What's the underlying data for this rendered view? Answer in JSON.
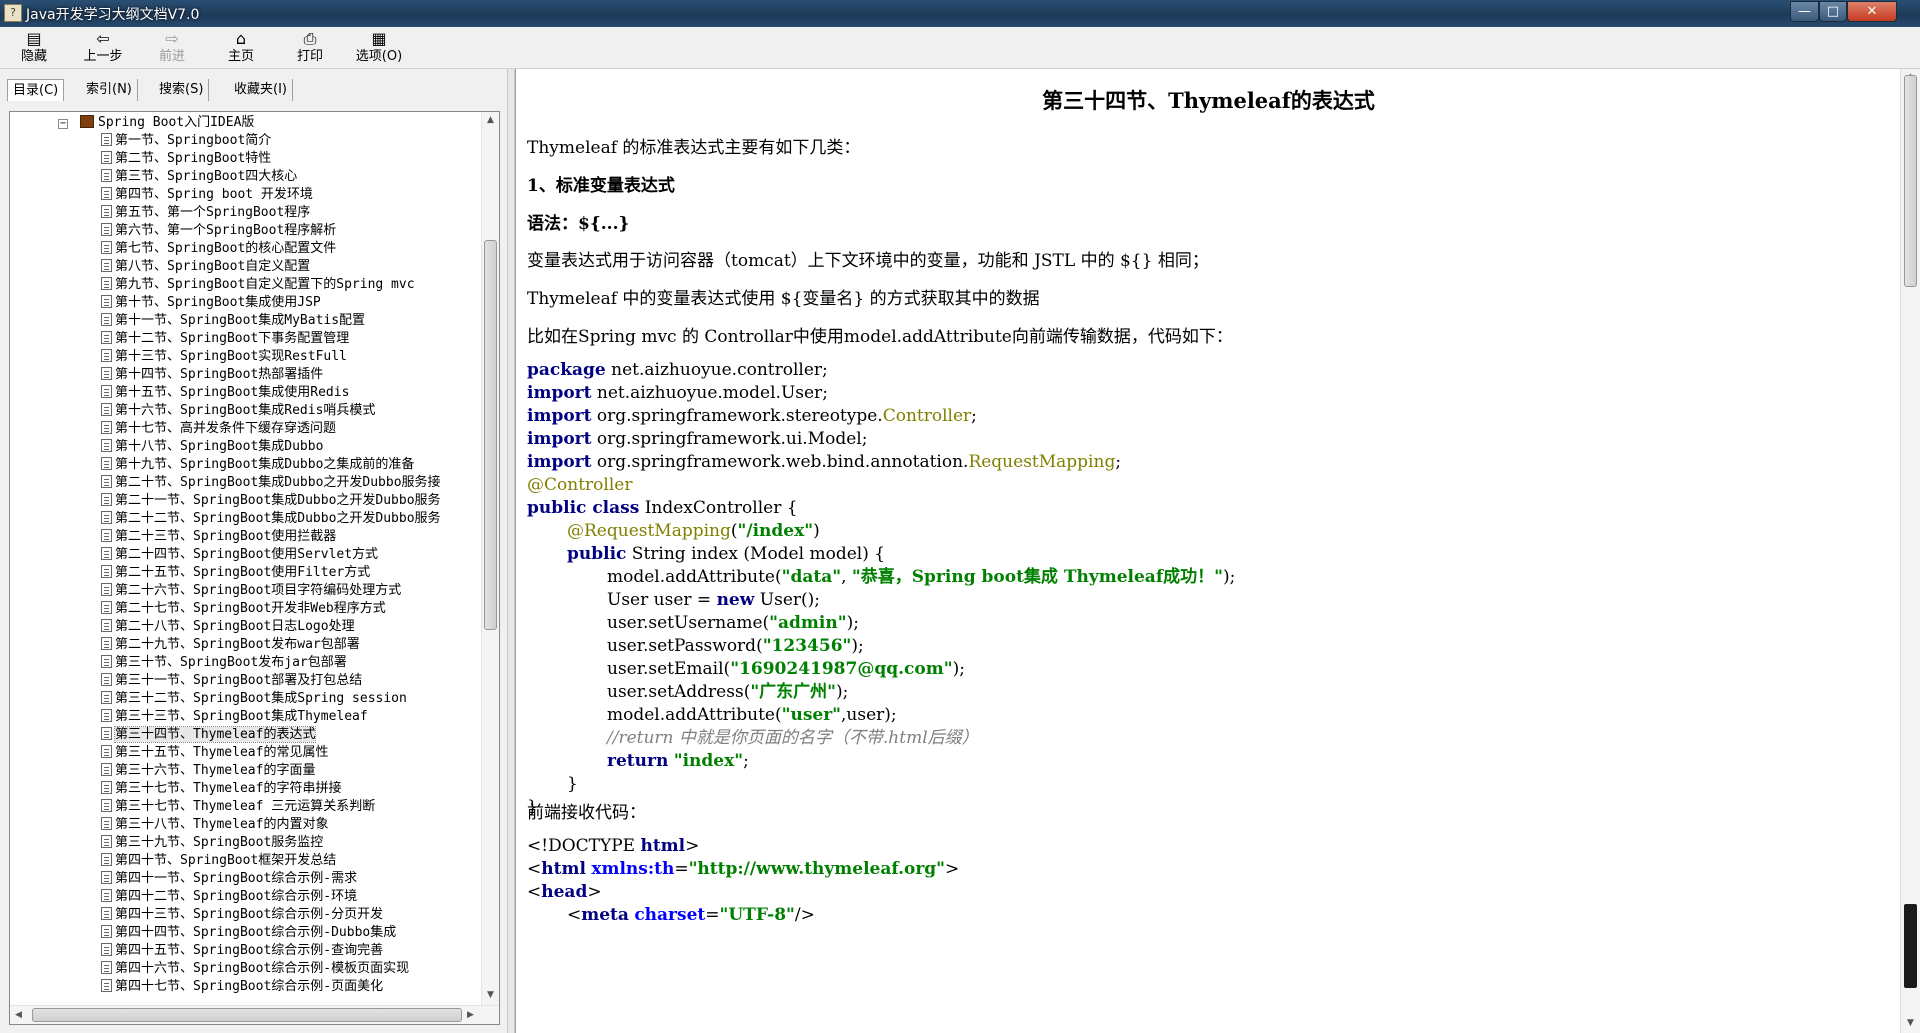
{
  "window": {
    "title": "Java开发学习大纲文档V7.0",
    "min": "—",
    "max": "□",
    "close": "✕"
  },
  "toolbar": [
    {
      "label": "隐藏",
      "icon": "hide-icon",
      "glyph": "▤"
    },
    {
      "label": "上一步",
      "icon": "back-arrow-icon",
      "glyph": "⇦"
    },
    {
      "label": "前进",
      "icon": "forward-arrow-icon",
      "glyph": "⇨"
    },
    {
      "label": "主页",
      "icon": "home-icon",
      "glyph": "⌂"
    },
    {
      "label": "打印",
      "icon": "printer-icon",
      "glyph": "⎙"
    },
    {
      "label": "选项(O)",
      "icon": "options-icon",
      "glyph": "▦"
    }
  ],
  "nav_tabs": [
    "目录(C)",
    "索引(N)",
    "搜索(S)",
    "收藏夹(I)"
  ],
  "tree": {
    "root": "Spring Boot入门IDEA版",
    "selected_index": 33,
    "items": [
      "第一节、Springboot简介",
      "第二节、SpringBoot特性",
      "第三节、SpringBoot四大核心",
      "第四节、Spring boot 开发环境",
      "第五节、第一个SpringBoot程序",
      "第六节、第一个SpringBoot程序解析",
      "第七节、SpringBoot的核心配置文件",
      "第八节、SpringBoot自定义配置",
      "第九节、SpringBoot自定义配置下的Spring mvc",
      "第十节、SpringBoot集成使用JSP",
      "第十一节、SpringBoot集成MyBatis配置",
      "第十二节、SpringBoot下事务配置管理",
      "第十三节、SpringBoot实现RestFull",
      "第十四节、SpringBoot热部署插件",
      "第十五节、SpringBoot集成使用Redis",
      "第十六节、SpringBoot集成Redis哨兵模式",
      "第十七节、高并发条件下缓存穿透问题",
      "第十八节、SpringBoot集成Dubbo",
      "第十九节、SpringBoot集成Dubbo之集成前的准备",
      "第二十节、SpringBoot集成Dubbo之开发Dubbo服务接",
      "第二十一节、SpringBoot集成Dubbo之开发Dubbo服务",
      "第二十二节、SpringBoot集成Dubbo之开发Dubbo服务",
      "第二十三节、SpringBoot使用拦截器",
      "第二十四节、SpringBoot使用Servlet方式",
      "第二十五节、SpringBoot使用Filter方式",
      "第二十六节、SpringBoot项目字符编码处理方式",
      "第二十七节、SpringBoot开发非Web程序方式",
      "第二十八节、SpringBoot日志Logo处理",
      "第二十九节、SpringBoot发布war包部署",
      "第三十节、SpringBoot发布jar包部署",
      "第三十一节、SpringBoot部署及打包总结",
      "第三十二节、SpringBoot集成Spring session",
      "第三十三节、SpringBoot集成Thymeleaf",
      "第三十四节、Thymeleaf的表达式",
      "第三十五节、Thymeleaf的常见属性",
      "第三十六节、Thymeleaf的字面量",
      "第三十七节、Thymeleaf的字符串拼接",
      "第三十七节、Thymeleaf 三元运算关系判断",
      "第三十八节、Thymeleaf的内置对象",
      "第三十九节、SpringBoot服务监控",
      "第四十节、SpringBoot框架开发总结",
      "第四十一节、SpringBoot综合示例-需求",
      "第四十二节、SpringBoot综合示例-环境",
      "第四十三节、SpringBoot综合示例-分页开发",
      "第四十四节、SpringBoot综合示例-Dubbo集成",
      "第四十五节、SpringBoot综合示例-查询完善",
      "第四十六节、SpringBoot综合示例-模板页面实现",
      "第四十七节、SpringBoot综合示例-页面美化"
    ]
  },
  "article": {
    "heading": "第三十四节、Thymeleaf的表达式",
    "intro": "Thymeleaf 的标准表达式主要有如下几类：",
    "section1": "1、标准变量表达式",
    "syntax": "语法：${...}",
    "para1": "变量表达式用于访问容器（tomcat）上下文环境中的变量，功能和 JSTL 中的 ${} 相同；",
    "para2": "Thymeleaf 中的变量表达式使用 ${变量名} 的方式获取其中的数据",
    "para3": "比如在Spring mvc 的 Controllar中使用model.addAttribute向前端传输数据，代码如下：",
    "frontend": "前端接收代码："
  },
  "java_code": {
    "l1": {
      "kw": "package",
      "rest": " net.aizhuoyue.controller;"
    },
    "l2": {
      "kw": "import",
      "rest": " net.aizhuoyue.model.User;"
    },
    "l3": {
      "kw": "import",
      "rest": " org.springframework.stereotype.",
      "an": "Controller",
      "end": ";"
    },
    "l4": {
      "kw": "import",
      "rest": " org.springframework.ui.Model;"
    },
    "l5": {
      "kw": "import",
      "rest": " org.springframework.web.bind.annotation.",
      "an": "RequestMapping",
      "end": ";"
    },
    "l6": {
      "an": "@Controller"
    },
    "l7": {
      "kw": "public class",
      "rest": " IndexController {"
    },
    "l8": {
      "an": "@RequestMapping",
      "p1": "(",
      "st": "\"/index\"",
      "p2": ")"
    },
    "l9": {
      "kw": "public",
      "rest": " String index (Model model) {"
    },
    "l10": {
      "a": "model.addAttribute(",
      "s1": "\"data\"",
      "b": ", ",
      "s2": "\"恭喜，Spring boot集成 Thymeleaf成功！\"",
      "c": ");"
    },
    "l11": {
      "a": "User user = ",
      "kw": "new",
      "b": " User();"
    },
    "l12": {
      "a": "user.setUsername(",
      "st": "\"admin\"",
      "b": ");"
    },
    "l13": {
      "a": "user.setPassword(",
      "st": "\"123456\"",
      "b": ");"
    },
    "l14": {
      "a": "user.setEmail(",
      "st": "\"1690241987@qq.com\"",
      "b": ");"
    },
    "l15": {
      "a": "user.setAddress(",
      "st": "\"广东广州\"",
      "b": ");"
    },
    "l16": {
      "a": "model.addAttribute(",
      "st": "\"user\"",
      "b": ",user);"
    },
    "l17": {
      "cm": "//return 中就是你页面的名字（不带.html后缀）"
    },
    "l18": {
      "kw": "return",
      "sp": " ",
      "st": "\"index\"",
      "b": ";"
    },
    "l19": {
      "a": "}"
    },
    "l20": {
      "a": "}"
    }
  },
  "html_code": {
    "l1": {
      "a": "<!DOCTYPE ",
      "tg": "html",
      "b": ">"
    },
    "l2": {
      "a": "<",
      "tg": "html",
      "sp": " ",
      "at": "xmlns:th",
      "eq": "=",
      "st": "\"http://www.thymeleaf.org\"",
      "b": ">"
    },
    "l3": {
      "a": "<",
      "tg": "head",
      "b": ">"
    },
    "l4": {
      "a": "<",
      "tg": "meta",
      "sp": " ",
      "at": "charset",
      "eq": "=",
      "st": "\"UTF-8\"",
      "b": "/>"
    }
  }
}
